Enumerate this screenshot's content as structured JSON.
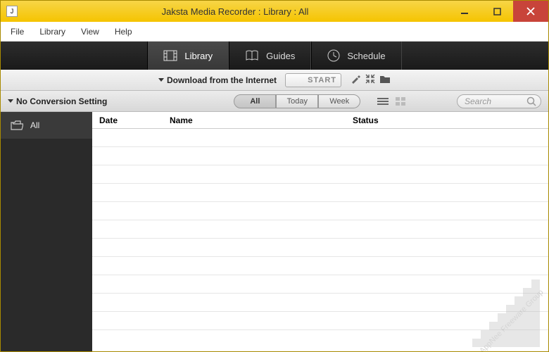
{
  "window": {
    "title": "Jaksta Media Recorder : Library : All"
  },
  "menu": {
    "file": "File",
    "library": "Library",
    "view": "View",
    "help": "Help"
  },
  "tabs": {
    "library": "Library",
    "guides": "Guides",
    "schedule": "Schedule"
  },
  "toolbar": {
    "download_label": "Download from the Internet",
    "start_label": "START"
  },
  "filterbar": {
    "conversion_label": "No Conversion Setting",
    "seg": {
      "all": "All",
      "today": "Today",
      "week": "Week"
    },
    "search_placeholder": "Search"
  },
  "sidebar": {
    "items": [
      {
        "label": "All"
      }
    ]
  },
  "columns": {
    "date": "Date",
    "name": "Name",
    "status": "Status"
  },
  "watermark": "AppNee Freeware Group"
}
